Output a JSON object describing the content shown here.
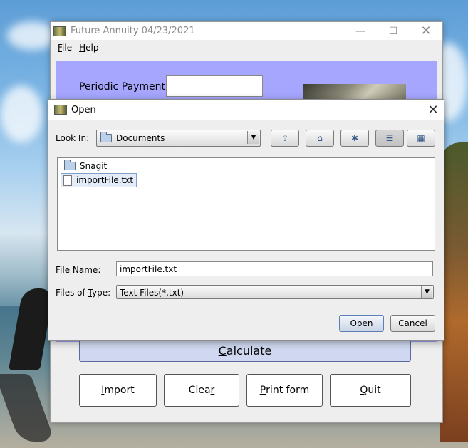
{
  "app": {
    "title": "Future Annuity 04/23/2021",
    "menu": {
      "file_mnemonic": "F",
      "file_rest": "ile",
      "help_mnemonic": "H",
      "help_rest": "elp"
    },
    "periodic_payment_label": "Periodic Payment:",
    "periodic_payment_value": "",
    "buttons": {
      "calculate_mnemonic": "C",
      "calculate_rest": "alculate",
      "import_mnemonic": "I",
      "import_rest": "mport",
      "clear_pre": "Clea",
      "clear_mnemonic": "r",
      "print_mnemonic": "P",
      "print_rest": "rint form",
      "quit_mnemonic": "Q",
      "quit_rest": "uit"
    },
    "panel_color": "#a6a6ff"
  },
  "dialog": {
    "title": "Open",
    "look_in_pre": "Look ",
    "look_in_mnemonic": "I",
    "look_in_post": "n:",
    "look_in_value": "Documents",
    "files": [
      {
        "name": "Snagit",
        "type": "folder",
        "selected": false
      },
      {
        "name": "importFile.txt",
        "type": "file",
        "selected": true
      }
    ],
    "file_name_pre": "File ",
    "file_name_mnemonic": "N",
    "file_name_post": "ame:",
    "file_name_value": "importFile.txt",
    "files_of_type_pre": "Files of ",
    "files_of_type_mnemonic": "T",
    "files_of_type_post": "ype:",
    "files_of_type_value": "Text Files(*.txt)",
    "open_button": "Open",
    "cancel_button": "Cancel",
    "toolbar_icons": [
      "up-one-level-icon",
      "home-icon",
      "new-folder-icon",
      "list-view-icon",
      "details-view-icon"
    ]
  }
}
